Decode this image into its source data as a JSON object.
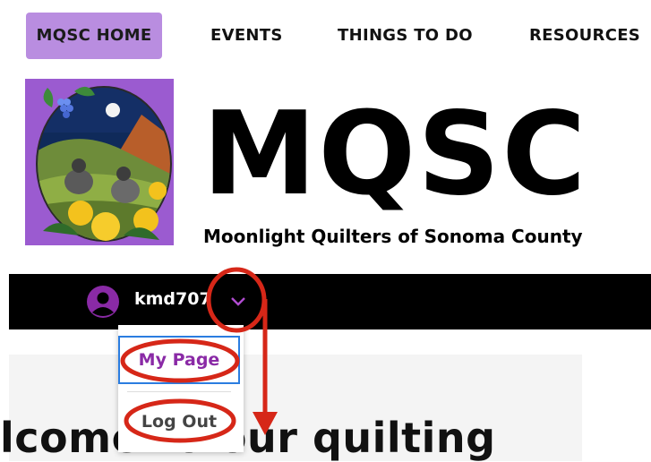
{
  "nav": {
    "items": [
      {
        "label": "MQSC HOME",
        "active": true
      },
      {
        "label": "EVENTS"
      },
      {
        "label": "THINGS TO DO"
      },
      {
        "label": "RESOURCES"
      }
    ]
  },
  "header": {
    "title": "MQSC",
    "subtitle": "Moonlight Quilters of Sonoma County"
  },
  "member": {
    "username": "kmd707"
  },
  "dropdown": {
    "my_page": "My Page",
    "log_out": "Log Out"
  },
  "main": {
    "welcome_text": "lcome to our quilting"
  },
  "colors": {
    "nav_active_bg": "#b98de0",
    "bar_bg": "#000000",
    "accent_purple": "#8a2aa6",
    "annotation_red": "#d62718",
    "highlight_blue": "#2b7de0"
  },
  "icons": [
    "user-avatar-icon",
    "chevron-down-icon",
    "logo-image"
  ]
}
